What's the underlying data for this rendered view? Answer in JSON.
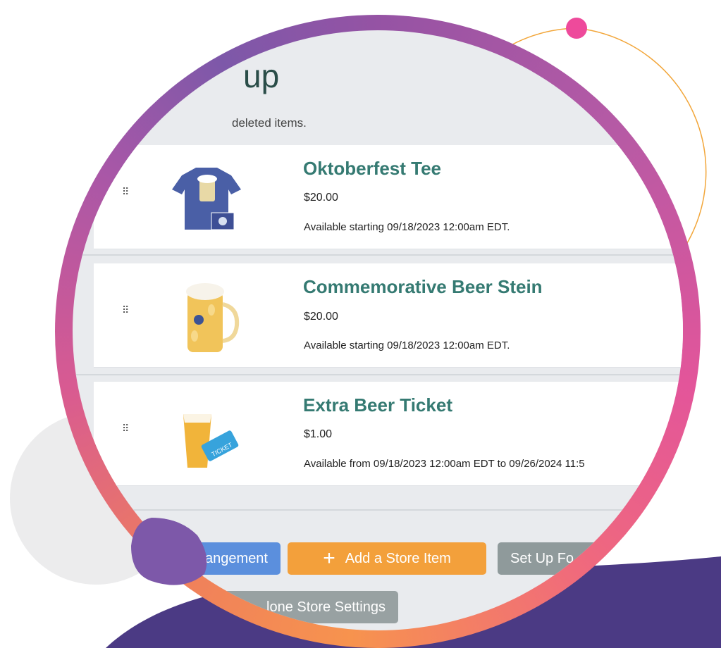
{
  "page": {
    "heading_fragment": "up",
    "subtitle": "deleted items."
  },
  "items": [
    {
      "title": "Oktoberfest Tee",
      "price": "$20.00",
      "availability": "Available starting 09/18/2023 12:00am EDT.",
      "image": "blue-tshirt-image"
    },
    {
      "title": "Commemorative Beer Stein",
      "price": "$20.00",
      "availability": "Available starting 09/18/2023 12:00am EDT.",
      "image": "beer-stein-image"
    },
    {
      "title": "Extra Beer Ticket",
      "price": "$1.00",
      "availability": "Available from 09/18/2023 12:00am EDT to 09/26/2024 11:5",
      "image": "beer-and-ticket-image"
    }
  ],
  "buttons": {
    "arrangement": "rangement",
    "add_store_item": "Add a Store Item",
    "set_up": "Set Up Fo",
    "store_settings": "lone Store Settings"
  },
  "colors": {
    "title_teal": "#357a72",
    "button_blue": "#5b8fdd",
    "button_orange": "#f3a03b",
    "button_gray": "#8f9a9b",
    "ring_pink": "#e3559a",
    "ring_purple": "#7d58a9",
    "dot_pink": "#ee4a9b"
  }
}
